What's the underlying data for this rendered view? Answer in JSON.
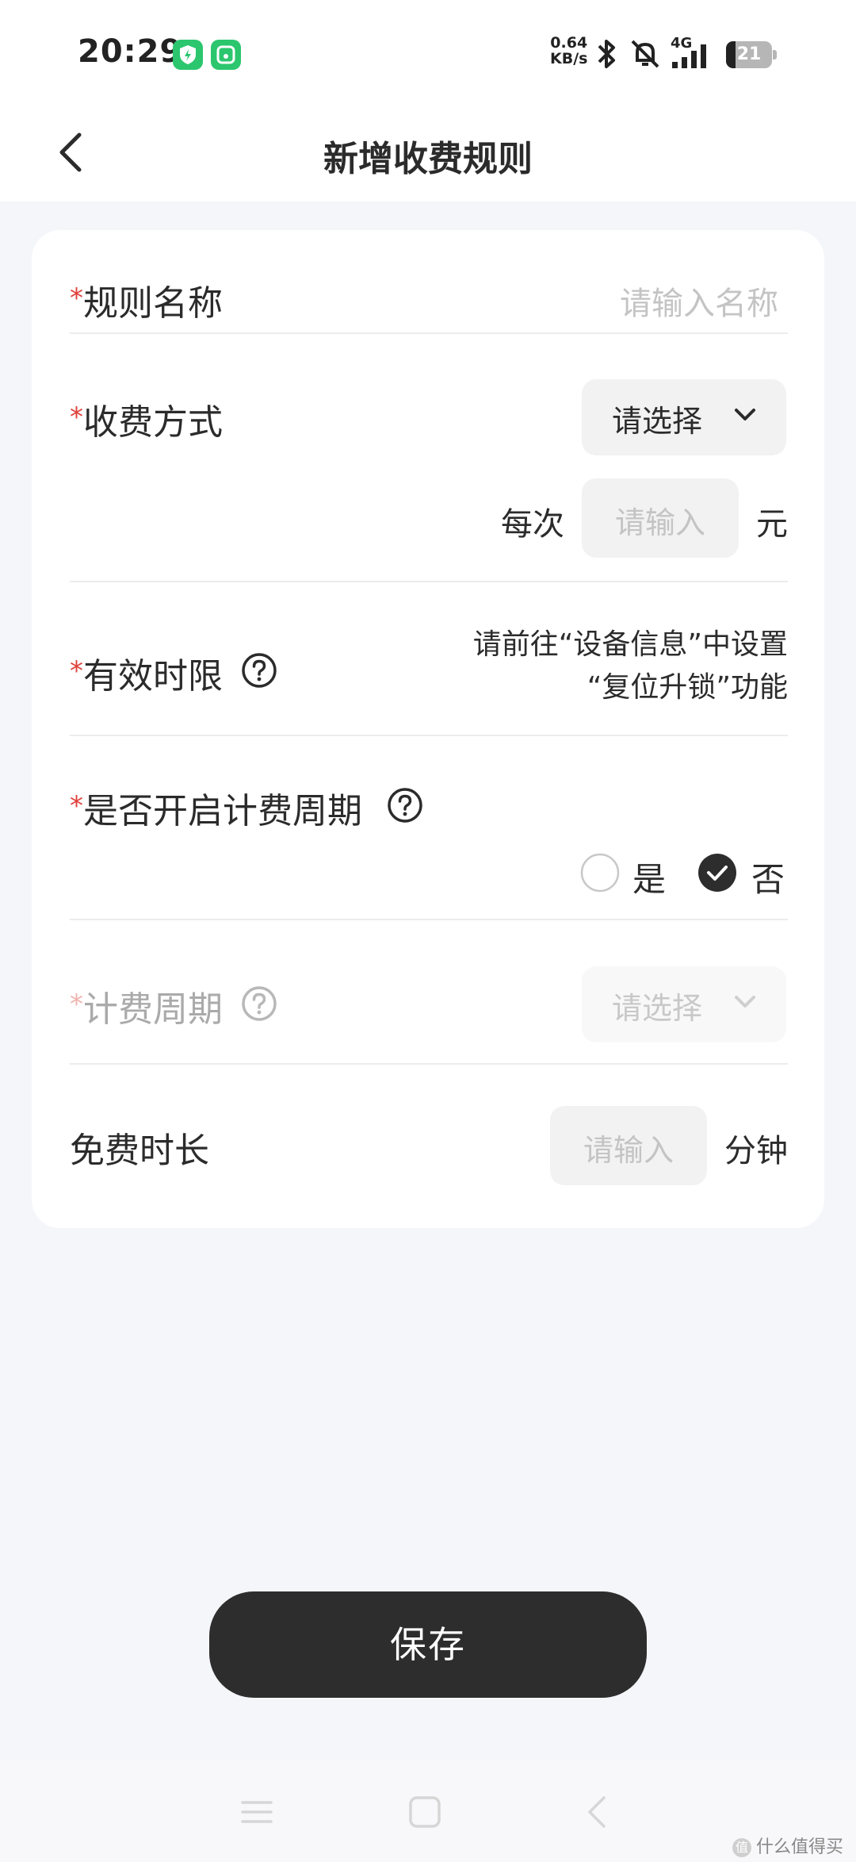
{
  "status_bar": {
    "time": "20:29",
    "net_speed_value": "0.64",
    "net_speed_unit": "KB/s",
    "network_type": "4G",
    "battery_level": "21",
    "battery_fraction": 0.21
  },
  "header": {
    "title": "新增收费规则"
  },
  "form": {
    "required_mark": "*",
    "rule_name": {
      "label": "规则名称",
      "placeholder": "请输入名称"
    },
    "charge_method": {
      "label": "收费方式",
      "select_value": "请选择",
      "per_time_label": "每次",
      "input_placeholder": "请输入",
      "unit": "元"
    },
    "validity": {
      "label": "有效时限",
      "note_line1": "请前往“设备信息”中设置",
      "note_line2": "“复位升锁”功能"
    },
    "billing_cycle_enabled": {
      "label": "是否开启计费周期",
      "option_yes": "是",
      "option_no": "否",
      "selected": "否"
    },
    "billing_cycle": {
      "label": "计费周期",
      "select_value": "请选择"
    },
    "free_duration": {
      "label": "免费时长",
      "input_placeholder": "请输入",
      "unit": "分钟"
    }
  },
  "actions": {
    "save_label": "保存"
  },
  "watermark": {
    "text": "什么值得买",
    "badge": "值"
  },
  "colors": {
    "required": "#e0413b",
    "save_button": "#2d2d2d",
    "background": "#f5f6fa",
    "status_icon": "#2bc66e"
  }
}
